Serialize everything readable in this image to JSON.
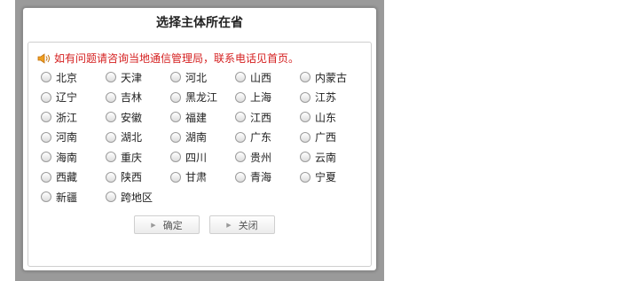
{
  "dialog": {
    "title": "选择主体所在省",
    "notice": "如有问题请咨询当地通信管理局，联系电话见首页。",
    "provinces": [
      "北京",
      "天津",
      "河北",
      "山西",
      "内蒙古",
      "辽宁",
      "吉林",
      "黑龙江",
      "上海",
      "江苏",
      "浙江",
      "安徽",
      "福建",
      "江西",
      "山东",
      "河南",
      "湖北",
      "湖南",
      "广东",
      "广西",
      "海南",
      "重庆",
      "四川",
      "贵州",
      "云南",
      "西藏",
      "陕西",
      "甘肃",
      "青海",
      "宁夏",
      "新疆",
      "跨地区"
    ],
    "confirm_label": "确定",
    "close_label": "关闭"
  },
  "colors": {
    "notice": "#d52020",
    "border": "#cfcfcf",
    "backdrop": "#9a9a9a"
  },
  "icons": {
    "notice": "speaker-icon",
    "button_arrow": "triangle-right-icon"
  }
}
